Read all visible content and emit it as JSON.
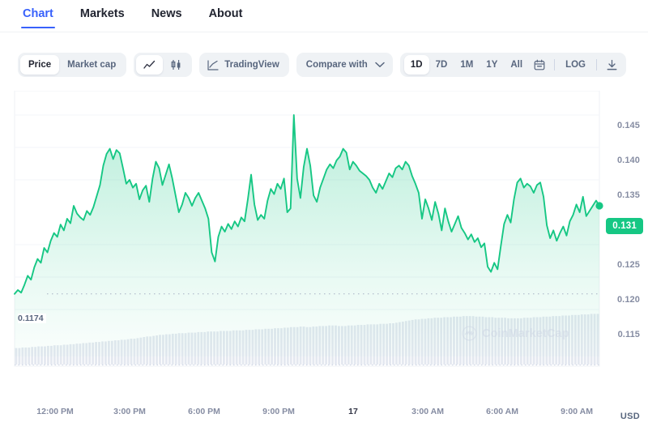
{
  "tabs": [
    {
      "label": "Chart",
      "active": true
    },
    {
      "label": "Markets",
      "active": false
    },
    {
      "label": "News",
      "active": false
    },
    {
      "label": "About",
      "active": false
    }
  ],
  "toolbar": {
    "metric_price": "Price",
    "metric_marketcap": "Market cap",
    "line_icon": "line-chart-icon",
    "candle_icon": "candlestick-icon",
    "tradingview_label": "TradingView",
    "tradingview_icon": "tradingview-icon",
    "compare_label": "Compare with",
    "compare_caret_icon": "chevron-down-icon",
    "ranges": [
      "1D",
      "7D",
      "1M",
      "1Y",
      "All"
    ],
    "active_range": "1D",
    "calendar_icon": "calendar-icon",
    "log_label": "LOG",
    "download_icon": "download-icon"
  },
  "watermark": {
    "text": "CoinMarketCap",
    "logo_icon": "coinmarketcap-logo-icon"
  },
  "chart_data": {
    "type": "area",
    "title": "",
    "xlabel": "",
    "ylabel": "USD",
    "unit": "USD",
    "currency": "USD",
    "current_price": "0.131",
    "low_label": "0.1174",
    "low_value": 0.1174,
    "ylim": [
      0.1125,
      0.1475
    ],
    "yticks": [
      0.145,
      0.14,
      0.135,
      0.125,
      0.12,
      0.115
    ],
    "ytick_labels": [
      "0.145",
      "0.140",
      "0.135",
      "0.125",
      "0.120",
      "0.115"
    ],
    "grid": true,
    "legend": "none",
    "line_color": "#16c784",
    "fill_color": "#16c784",
    "xticks": [
      "12:00 PM",
      "3:00 PM",
      "6:00 PM",
      "9:00 PM",
      "17",
      "3:00 AM",
      "6:00 AM",
      "9:00 AM"
    ],
    "xtick_bold": [
      "17"
    ],
    "series": [
      {
        "name": "Price",
        "values": [
          0.1174,
          0.118,
          0.1176,
          0.1188,
          0.1202,
          0.1196,
          0.1215,
          0.1228,
          0.1222,
          0.1245,
          0.1238,
          0.1256,
          0.1268,
          0.1262,
          0.1281,
          0.1272,
          0.129,
          0.1283,
          0.131,
          0.1298,
          0.1292,
          0.1288,
          0.1302,
          0.1296,
          0.1308,
          0.1325,
          0.1342,
          0.1372,
          0.139,
          0.1398,
          0.1382,
          0.1396,
          0.1391,
          0.1368,
          0.1344,
          0.135,
          0.1338,
          0.1344,
          0.132,
          0.1334,
          0.1341,
          0.1316,
          0.1352,
          0.1378,
          0.1368,
          0.1342,
          0.1358,
          0.1374,
          0.1352,
          0.1326,
          0.13,
          0.1312,
          0.133,
          0.1322,
          0.131,
          0.1322,
          0.133,
          0.1318,
          0.1306,
          0.129,
          0.1238,
          0.1224,
          0.1262,
          0.1278,
          0.127,
          0.1282,
          0.1274,
          0.1286,
          0.1278,
          0.1292,
          0.1286,
          0.132,
          0.1358,
          0.1312,
          0.1288,
          0.1296,
          0.129,
          0.1318,
          0.1336,
          0.1328,
          0.1344,
          0.1336,
          0.1352,
          0.13,
          0.1306,
          0.145,
          0.1352,
          0.1322,
          0.137,
          0.1398,
          0.1372,
          0.1326,
          0.1316,
          0.1338,
          0.1352,
          0.1366,
          0.1374,
          0.1368,
          0.138,
          0.1386,
          0.1398,
          0.1392,
          0.1366,
          0.1378,
          0.1372,
          0.1364,
          0.136,
          0.1356,
          0.135,
          0.1338,
          0.133,
          0.1344,
          0.1336,
          0.1348,
          0.136,
          0.1354,
          0.1368,
          0.1372,
          0.1366,
          0.1378,
          0.1372,
          0.1356,
          0.1344,
          0.133,
          0.129,
          0.132,
          0.1306,
          0.1288,
          0.1316,
          0.1298,
          0.1272,
          0.1306,
          0.1286,
          0.127,
          0.1282,
          0.1294,
          0.1276,
          0.1268,
          0.1258,
          0.1266,
          0.1254,
          0.126,
          0.1246,
          0.1252,
          0.1216,
          0.1208,
          0.1222,
          0.1212,
          0.1248,
          0.1282,
          0.1296,
          0.1284,
          0.132,
          0.1346,
          0.1352,
          0.1338,
          0.1344,
          0.134,
          0.133,
          0.1342,
          0.1346,
          0.1324,
          0.128,
          0.126,
          0.1272,
          0.1256,
          0.1268,
          0.1278,
          0.1264,
          0.1286,
          0.1296,
          0.1312,
          0.13,
          0.1324,
          0.1294,
          0.1302,
          0.131,
          0.1318,
          0.131
        ]
      }
    ],
    "volume": {
      "name": "Volume",
      "color": "#cdd5e4",
      "values": [
        0.3,
        0.3,
        0.31,
        0.31,
        0.31,
        0.32,
        0.32,
        0.33,
        0.33,
        0.33,
        0.34,
        0.34,
        0.35,
        0.35,
        0.35,
        0.36,
        0.36,
        0.37,
        0.37,
        0.38,
        0.38,
        0.39,
        0.39,
        0.4,
        0.4,
        0.41,
        0.41,
        0.42,
        0.42,
        0.43,
        0.43,
        0.44,
        0.44,
        0.45,
        0.45,
        0.46,
        0.47,
        0.47,
        0.48,
        0.49,
        0.5,
        0.51,
        0.51,
        0.52,
        0.53,
        0.54,
        0.54,
        0.55,
        0.55,
        0.56,
        0.56,
        0.57,
        0.57,
        0.57,
        0.58,
        0.58,
        0.58,
        0.59,
        0.59,
        0.59,
        0.6,
        0.6,
        0.6,
        0.6,
        0.61,
        0.61,
        0.61,
        0.61,
        0.62,
        0.62,
        0.62,
        0.62,
        0.63,
        0.63,
        0.63,
        0.64,
        0.64,
        0.64,
        0.65,
        0.65,
        0.65,
        0.66,
        0.66,
        0.66,
        0.67,
        0.67,
        0.68,
        0.68,
        0.68,
        0.69,
        0.69,
        0.68,
        0.68,
        0.69,
        0.69,
        0.7,
        0.7,
        0.7,
        0.71,
        0.71,
        0.71,
        0.7,
        0.7,
        0.7,
        0.71,
        0.71,
        0.71,
        0.72,
        0.72,
        0.72,
        0.73,
        0.73,
        0.73,
        0.73,
        0.74,
        0.74,
        0.74,
        0.75,
        0.75,
        0.76,
        0.77,
        0.78,
        0.79,
        0.8,
        0.81,
        0.82,
        0.82,
        0.83,
        0.83,
        0.84,
        0.84,
        0.85,
        0.85,
        0.85,
        0.86,
        0.86,
        0.86,
        0.87,
        0.87,
        0.87,
        0.88,
        0.88,
        0.88,
        0.88,
        0.87,
        0.87,
        0.87,
        0.86,
        0.86,
        0.86,
        0.85,
        0.85,
        0.85,
        0.85,
        0.84,
        0.84,
        0.84,
        0.84,
        0.84,
        0.85,
        0.85,
        0.85,
        0.86,
        0.86,
        0.86,
        0.87,
        0.87,
        0.87,
        0.88,
        0.88,
        0.88,
        0.89,
        0.89,
        0.89,
        0.9,
        0.9,
        0.9,
        0.91,
        0.91,
        0.91,
        0.92,
        0.92,
        0.92
      ]
    }
  }
}
